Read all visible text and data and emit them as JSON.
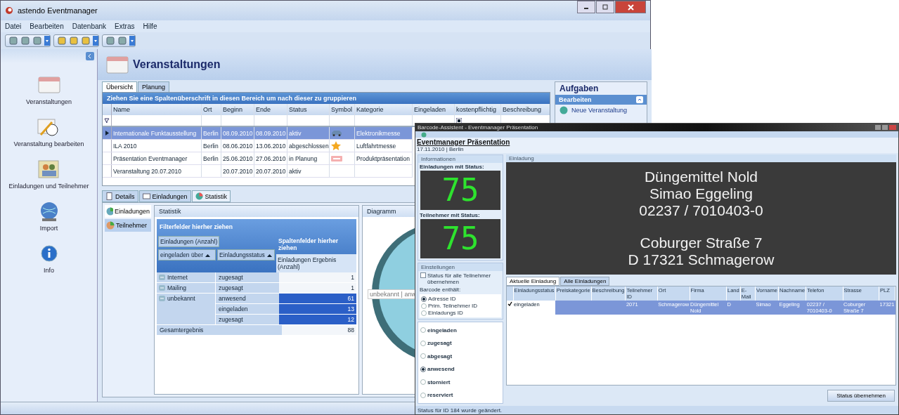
{
  "main_window": {
    "title": "astendo Eventmanager",
    "menu": [
      "Datei",
      "Bearbeiten",
      "Datenbank",
      "Extras",
      "Hilfe"
    ],
    "sidebar": [
      {
        "label": "Veranstaltungen",
        "kind": "calendar"
      },
      {
        "label": "Veranstaltung bearbeiten",
        "kind": "edit"
      },
      {
        "label": "Einladungen und Teilnehmer",
        "kind": "people"
      },
      {
        "label": "Import",
        "kind": "globe"
      },
      {
        "label": "Info",
        "kind": "info"
      }
    ],
    "page_title": "Veranstaltungen",
    "tabs": [
      {
        "label": "Übersicht",
        "selected": true
      },
      {
        "label": "Planung",
        "selected": false
      }
    ],
    "grid": {
      "group_hint": "Ziehen Sie eine Spaltenüberschrift in diesen Bereich um nach dieser zu gruppieren",
      "filter_checked": true,
      "columns": [
        "Name",
        "Ort",
        "Beginn",
        "Ende",
        "Status",
        "Symbol",
        "Kategorie",
        "Eingeladen",
        "kostenpflichtig",
        "Beschreibung"
      ],
      "rows": [
        {
          "selected": true,
          "name": "Internationale Funktausstellung",
          "ort": "Berlin",
          "beginn": "08.09.2010",
          "ende": "08.09.2010",
          "status": "aktiv",
          "kind": "car",
          "kategorie": "Elektronikmesse"
        },
        {
          "selected": false,
          "name": "ILA 2010",
          "ort": "Berlin",
          "beginn": "08.06.2010",
          "ende": "13.06.2010",
          "status": "abgeschlossen",
          "kind": "star",
          "kategorie": "Luftfahrtmesse"
        },
        {
          "selected": false,
          "name": "Präsentation Eventmanager",
          "ort": "Berlin",
          "beginn": "25.06.2010",
          "ende": "27.06.2010",
          "status": "in Planung",
          "kind": "sign",
          "kategorie": "Produktpräsentation"
        },
        {
          "selected": false,
          "name": "Veranstaltung 20.07.2010",
          "beginn": "20.07.2010",
          "ende": "20.07.2010",
          "status": "aktiv"
        }
      ]
    },
    "tasks": {
      "title": "Aufgaben",
      "section": "Bearbeiten",
      "items": [
        "Neue Veranstaltung"
      ]
    },
    "detail_tabs": [
      {
        "label": "Details",
        "kind": "document",
        "selected": false
      },
      {
        "label": "Einladungen",
        "kind": "card",
        "selected": false
      },
      {
        "label": "Statistik",
        "kind": "pie",
        "selected": true
      }
    ],
    "stat_tabs": [
      {
        "label": "Einladungen",
        "selected": true
      },
      {
        "label": "Teilnehmer",
        "selected": false
      }
    ],
    "statistik": {
      "title": "Statistik",
      "filter_hint": "Filterfelder hierher ziehen",
      "data_field": "Einladungen (Anzahl)",
      "column_hint": "Spaltenfelder hierher ziehen",
      "row_fields": [
        "eingeladen über",
        "Einladungsstatus"
      ],
      "result_header": "Einladungen Ergebnis (Anzahl)",
      "groups": [
        {
          "label": "Internet",
          "rows": [
            {
              "status": "zugesagt",
              "value": "1",
              "selected": false
            }
          ]
        },
        {
          "label": "Mailing",
          "rows": [
            {
              "status": "zugesagt",
              "value": "1",
              "selected": false
            }
          ]
        },
        {
          "label": "unbekannt",
          "rows": [
            {
              "status": "anwesend",
              "value": "61",
              "selected": true
            },
            {
              "status": "eingeladen",
              "value": "13",
              "selected": true
            },
            {
              "status": "zugesagt",
              "value": "12",
              "selected": true
            }
          ]
        }
      ],
      "total_label": "Gesamtergebnis",
      "total": "88"
    },
    "diagram": {
      "title": "Diagramm",
      "label": "unbekannt | anw"
    }
  },
  "barcode_window": {
    "title": "Barcode-Assistent - Eventmanager Präsentation",
    "heading": "Eventmanager Präsentation",
    "subheading": "17.11.2010 | Berlin",
    "info_panel": "Informationen",
    "counters": [
      {
        "label": "Einladungen mit Status:",
        "value": "75"
      },
      {
        "label": "Teilnehmer mit Status:",
        "value": "75"
      }
    ],
    "invitation_panel": "Einladung",
    "display_blocks": [
      [
        "Düngemittel Nold",
        "Simao Eggeling",
        "02237 / 7010403-0"
      ],
      [
        "Coburger Straße 7",
        "D 17321 Schmagerow"
      ]
    ],
    "settings": {
      "title": "Einstellungen",
      "apply_all": {
        "label": "Status für alle Teilnehmer übernehmen",
        "checked": false
      },
      "barcode_label": "Barcode enthält:",
      "barcode_options": [
        {
          "label": "Adresse ID",
          "selected": true
        },
        {
          "label": "Prim. Teilnehmer ID",
          "selected": false
        },
        {
          "label": "Einladungs ID",
          "selected": false
        }
      ]
    },
    "statuses": [
      {
        "label": "eingeladen",
        "selected": false
      },
      {
        "label": "zugesagt",
        "selected": false
      },
      {
        "label": "abgesagt",
        "selected": false
      },
      {
        "label": "anwesend",
        "selected": true
      },
      {
        "label": "storniert",
        "selected": false
      },
      {
        "label": "reserviert",
        "selected": false
      }
    ],
    "grid_tabs": [
      {
        "label": "Aktuelle Einladung",
        "selected": true
      },
      {
        "label": "Alle Einladungen",
        "selected": false
      }
    ],
    "row": {
      "checked": true,
      "selected": true
    },
    "columns": [
      {
        "label": "Einladungsstatus",
        "value": "eingeladen"
      },
      {
        "label": "Preiskategorie"
      },
      {
        "label": "Beschreibung"
      },
      {
        "label": "Teilnehmer ID",
        "value": "2071"
      },
      {
        "label": "Ort",
        "value": "Schmagerow"
      },
      {
        "label": "Firma",
        "value": "Düngemittel Nold"
      },
      {
        "label": "Land",
        "value": "D"
      },
      {
        "label": "E-Mail"
      },
      {
        "label": "Vorname",
        "value": "Simao"
      },
      {
        "label": "Nachname",
        "value": "Eggeling"
      },
      {
        "label": "Telefon",
        "value": "02237 / 7010403-0"
      },
      {
        "label": "Strasse",
        "value": "Coburger Straße 7"
      },
      {
        "label": "PLZ",
        "value": "17321"
      }
    ],
    "button": "Status übernehmen",
    "status_bar": "Status für ID 184 wurde geändert."
  }
}
